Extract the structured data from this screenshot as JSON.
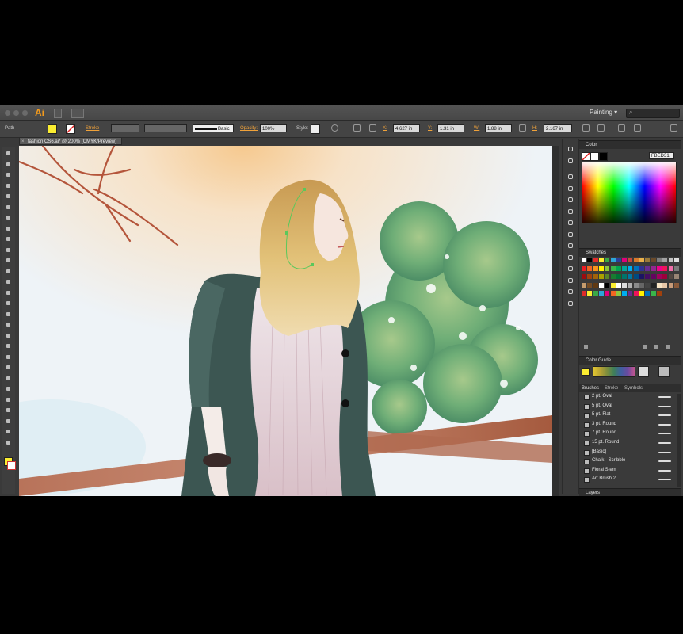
{
  "window": {
    "app_logo": "Ai",
    "workspace": "Painting",
    "workspace_arrow": "▾",
    "search_icon": "⌕"
  },
  "control_bar": {
    "selection_type": "Path",
    "stroke_label": "Stroke",
    "brush_label": "Basic",
    "opacity_label": "Opacity:",
    "opacity_value": "100%",
    "style_label": "Style:",
    "x_label": "X:",
    "x_value": "4.627 in",
    "y_label": "Y:",
    "y_value": "1.31 in",
    "w_label": "W:",
    "w_value": "1.88 in",
    "h_label": "H:",
    "h_value": "2.167 in"
  },
  "document": {
    "tab_title": "fashion CS6.ai* @ 200% (CMYK/Preview)",
    "close_glyph": "×"
  },
  "panels": {
    "color": {
      "title": "Color",
      "hex_value": "FBED31"
    },
    "swatches": {
      "title": "Swatches"
    },
    "color_guide": {
      "title": "Color Guide"
    },
    "brushes": {
      "tabs": [
        "Brushes",
        "Stroke",
        "Symbols"
      ],
      "items": [
        "2 pt. Oval",
        "5 pt. Oval",
        "5 pt. Flat",
        "3 pt. Round",
        "7 pt. Round",
        "15 pt. Round",
        "[Basic]",
        "Chalk - Scribble",
        "Floral Stem",
        "Art Brush 2"
      ]
    },
    "layers": {
      "title": "Layers"
    }
  },
  "colors": {
    "accent_orange": "#f0a23a",
    "chrome_dark": "#3a3a3a",
    "fill_yellow": "#fbed31"
  },
  "icons": {
    "tools": [
      "selection-tool-icon",
      "direct-selection-tool-icon",
      "magic-wand-icon",
      "lasso-icon",
      "pen-tool-icon",
      "type-tool-icon",
      "line-tool-icon",
      "rectangle-tool-icon",
      "paintbrush-icon",
      "pencil-icon",
      "blob-brush-icon",
      "eraser-icon",
      "rotate-icon",
      "scale-icon",
      "width-tool-icon",
      "free-transform-icon",
      "shape-builder-icon",
      "perspective-grid-icon",
      "mesh-icon",
      "gradient-icon",
      "eyedropper-icon",
      "blend-icon",
      "symbol-sprayer-icon",
      "graph-icon",
      "artboard-icon",
      "slice-icon",
      "hand-icon",
      "zoom-icon"
    ]
  }
}
